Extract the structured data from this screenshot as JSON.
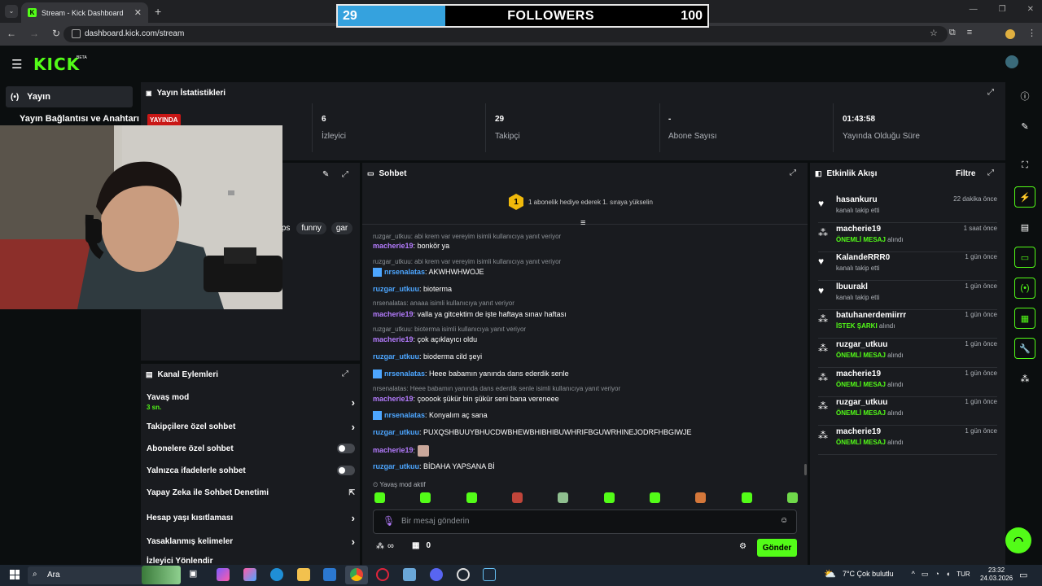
{
  "browser": {
    "tab_title": "Stream - Kick Dashboard",
    "url": "dashboard.kick.com/stream"
  },
  "overlay": {
    "current": "29",
    "label": "FOLLOWERS",
    "goal": "100",
    "progress_fraction": 0.29,
    "fill_color": "#35a2de"
  },
  "brand": {
    "logo": "KICK",
    "beta": "BETA",
    "accent": "#53fc18"
  },
  "nav": {
    "items": [
      {
        "label": "Yayın"
      },
      {
        "label": "Yayın Bağlantısı ve Anahtarı"
      }
    ]
  },
  "stats": {
    "title": "Yayın İstatistikleri",
    "live_badge": "YAYINDA",
    "items": [
      {
        "value": "6",
        "label": "İzleyici"
      },
      {
        "value": "29",
        "label": "Takipçi"
      },
      {
        "value": "-",
        "label": "Abone Sayısı"
      },
      {
        "value": "01:43:58",
        "label": "Yayında Olduğu Süre"
      }
    ]
  },
  "stream_panel": {
    "tags": [
      "fps",
      "funny",
      "gar"
    ]
  },
  "channel_actions": {
    "title": "Kanal Eylemleri",
    "items": [
      {
        "label": "Yavaş mod",
        "sub": "3 sn.",
        "control": "chevron"
      },
      {
        "label": "Takipçilere özel sohbet",
        "control": "chevron"
      },
      {
        "label": "Abonelere özel sohbet",
        "control": "toggle"
      },
      {
        "label": "Yalnızca ifadelerle sohbet",
        "control": "toggle"
      },
      {
        "label": "Yapay Zeka ile Sohbet Denetimi",
        "control": "external"
      },
      {
        "label": "Hesap yaşı kısıtlaması",
        "control": "chevron"
      },
      {
        "label": "Yasaklanmış kelimeler",
        "control": "chevron"
      },
      {
        "label": "İzleyici Yönlendir",
        "control": "none"
      }
    ]
  },
  "chat": {
    "title": "Sohbet",
    "gift_rank": "1",
    "gift_text": "1 abonelik hediye ederek 1. sıraya yükselin",
    "messages": [
      {
        "reply": "ruzgar_utkuu: abi krem var vereyim isimli kullanıcıya yanıt veriyor",
        "user": "macherie19",
        "color": "purple",
        "text": "bonkör ya"
      },
      {
        "reply": "ruzgar_utkuu: abi krem var vereyim isimli kullanıcıya yanıt veriyor",
        "user": "nrsenalatas",
        "color": "badge",
        "text": "AKWHWHWOJE"
      },
      {
        "reply": "",
        "user": "ruzgar_utkuu",
        "color": "blue",
        "text": "bioterma"
      },
      {
        "reply": "nrsenalatas: anaaa isimli kullanıcıya yanıt veriyor",
        "user": "macherie19",
        "color": "purple",
        "text": "valla ya gitcektim de işte haftaya sınav haftası"
      },
      {
        "reply": "ruzgar_utkuu: bioterma isimli kullanıcıya yanıt veriyor",
        "user": "macherie19",
        "color": "purple",
        "text": "çok açıklayıcı oldu"
      },
      {
        "reply": "",
        "user": "ruzgar_utkuu",
        "color": "blue",
        "text": "bioderma cild şeyi"
      },
      {
        "reply": "",
        "user": "nrsenalatas",
        "color": "badge",
        "text": "Heee babamın yanında dans ederdik senle"
      },
      {
        "reply": "nrsenalatas: Heee babamın yanında dans ederdik senle isimli kullanıcıya yanıt veriyor",
        "user": "macherie19",
        "color": "purple",
        "text": "çooook şükür bin şükür seni bana vereneee"
      },
      {
        "reply": "",
        "user": "nrsenalatas",
        "color": "badge",
        "text": "Konyalım aç sana"
      },
      {
        "reply": "",
        "user": "ruzgar_utkuu",
        "color": "blue",
        "text": "PUXQSHBUUYBHUCDWBHEWBHIBHIBUWHRIFBGUWRHINEJODRFHBGIWJE"
      },
      {
        "reply": "",
        "user": "macherie19",
        "color": "purple",
        "text": ""
      },
      {
        "reply": "",
        "user": "ruzgar_utkuu",
        "color": "blue",
        "text": "BİDAHA YAPSANA Bİ"
      }
    ],
    "slow_mode": "Yavaş mod aktif",
    "input_placeholder": "Bir mesaj gönderin",
    "points": "∞",
    "gifts": "0",
    "send_label": "Gönder"
  },
  "activity": {
    "title": "Etkinlik Akışı",
    "filter_label": "Filtre",
    "items": [
      {
        "name": "hasankuru",
        "pre": "kanalı takip etti",
        "hl": "",
        "post": "",
        "time": "22 dakika önce",
        "icon": "heart"
      },
      {
        "name": "macherie19",
        "pre": "",
        "hl": "ÖNEMLİ MESAJ",
        "post": " alındı",
        "time": "1 saat önce",
        "icon": "points"
      },
      {
        "name": "KalandeRRR0",
        "pre": "kanalı takip etti",
        "hl": "",
        "post": "",
        "time": "1 gün önce",
        "icon": "heart"
      },
      {
        "name": "lbuurakl",
        "pre": "kanalı takip etti",
        "hl": "",
        "post": "",
        "time": "1 gün önce",
        "icon": "heart"
      },
      {
        "name": "batuhanerdemiirrr",
        "pre": "",
        "hl": "İSTEK ŞARKI",
        "post": " alındı",
        "time": "1 gün önce",
        "icon": "points"
      },
      {
        "name": "ruzgar_utkuu",
        "pre": "",
        "hl": "ÖNEMLİ MESAJ",
        "post": " alındı",
        "time": "1 gün önce",
        "icon": "points"
      },
      {
        "name": "macherie19",
        "pre": "",
        "hl": "ÖNEMLİ MESAJ",
        "post": " alındı",
        "time": "1 gün önce",
        "icon": "points"
      },
      {
        "name": "ruzgar_utkuu",
        "pre": "",
        "hl": "ÖNEMLİ MESAJ",
        "post": " alındı",
        "time": "1 gün önce",
        "icon": "points"
      },
      {
        "name": "macherie19",
        "pre": "",
        "hl": "ÖNEMLİ MESAJ",
        "post": " alındı",
        "time": "1 gün önce",
        "icon": "points"
      }
    ]
  },
  "taskbar": {
    "search_label": "Ara",
    "weather": "7°C  Çok bulutlu",
    "lang": "TUR",
    "time": "23:32",
    "date": "24.03.2026"
  }
}
